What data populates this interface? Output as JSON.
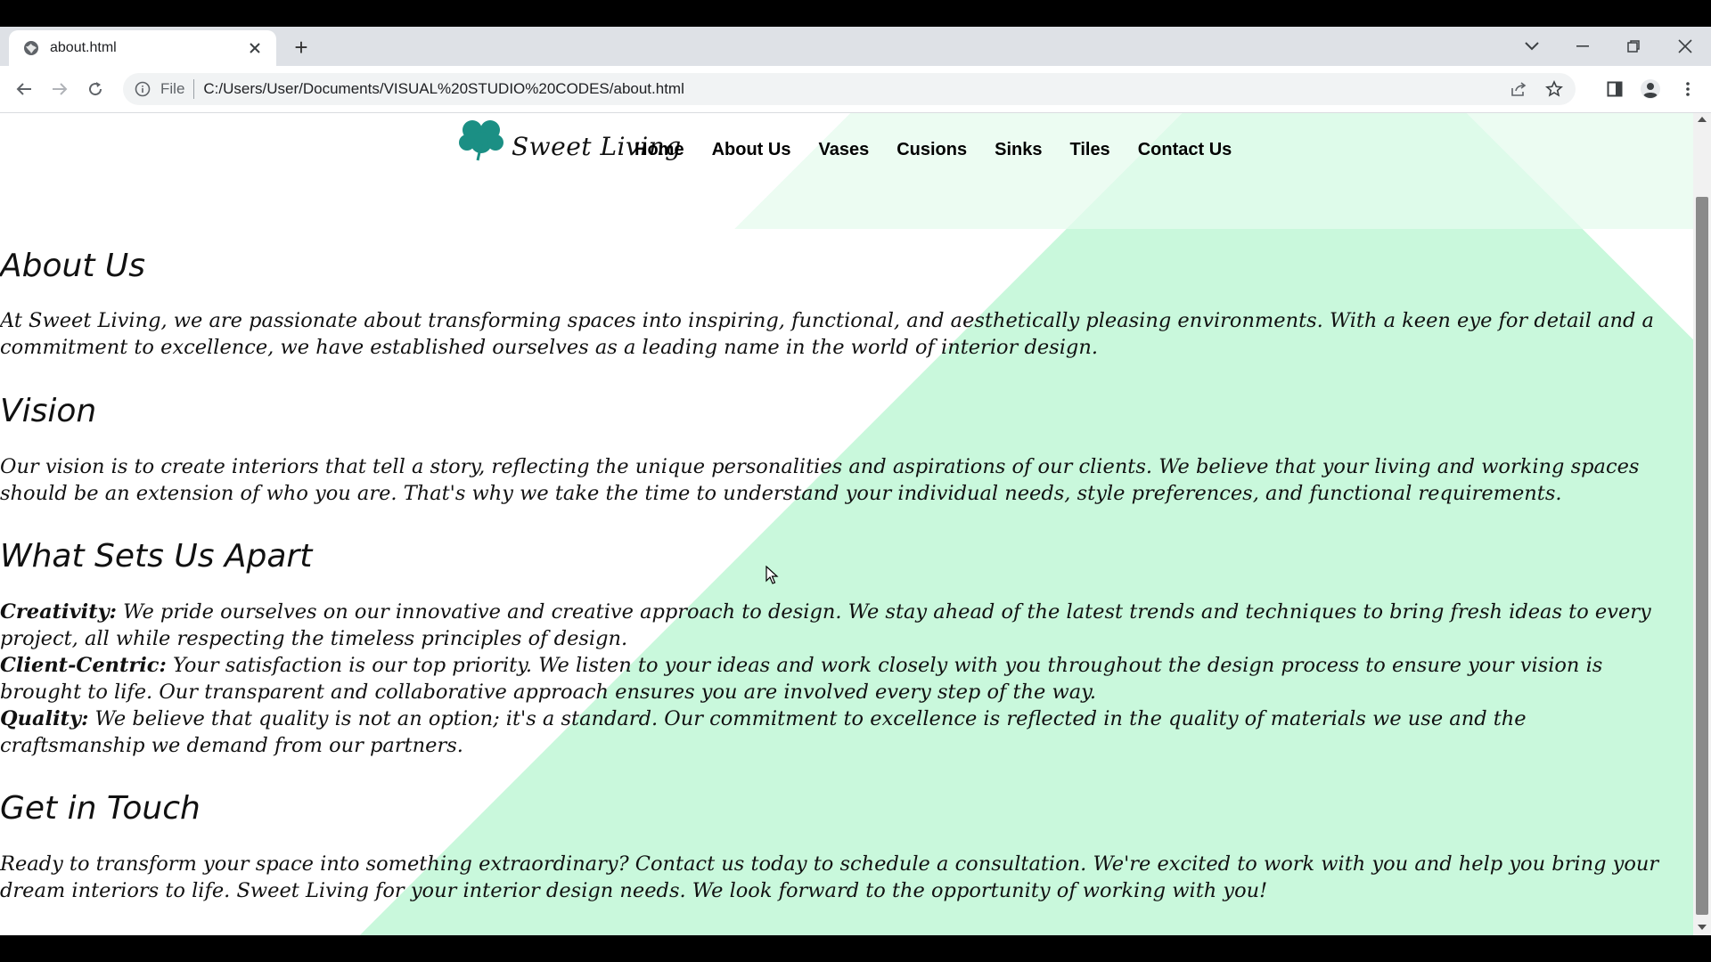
{
  "browser": {
    "tab_title": "about.html",
    "new_tab": "+",
    "omnibox": {
      "scheme_label": "File",
      "url": "C:/Users/User/Documents/VISUAL%20STUDIO%20CODES/about.html"
    }
  },
  "site": {
    "brand": "Sweet Living",
    "nav": [
      "Home",
      "About Us",
      "Vases",
      "Cusions",
      "Sinks",
      "Tiles",
      "Contact Us"
    ],
    "colors": {
      "mint": "#c9f8dc",
      "logo_teal": "#1b8f84"
    }
  },
  "content": {
    "about_heading": "About Us",
    "about_text": "At Sweet Living, we are passionate about transforming spaces into inspiring, functional, and aesthetically pleasing environments. With a keen eye for detail and a commitment to excellence, we have established ourselves as a leading name in the world of interior design.",
    "vision_heading": "Vision",
    "vision_text": "Our vision is to create interiors that tell a story, reflecting the unique personalities and aspirations of our clients. We believe that your living and working spaces should be an extension of who you are. That's why we take the time to understand your individual needs, style preferences, and functional requirements.",
    "apart_heading": "What Sets Us Apart",
    "points": [
      {
        "label": "Creativity:",
        "text": " We pride ourselves on our innovative and creative approach to design. We stay ahead of the latest trends and techniques to bring fresh ideas to every project, all while respecting the timeless principles of design."
      },
      {
        "label": "Client-Centric:",
        "text": " Your satisfaction is our top priority. We listen to your ideas and work closely with you throughout the design process to ensure your vision is brought to life. Our transparent and collaborative approach ensures you are involved every step of the way."
      },
      {
        "label": "Quality:",
        "text": " We believe that quality is not an option; it's a standard. Our commitment to excellence is reflected in the quality of materials we use and the craftsmanship we demand from our partners."
      }
    ],
    "touch_heading": "Get in Touch",
    "touch_text": "Ready to transform your space into something extraordinary? Contact us today to schedule a consultation. We're excited to work with you and help you bring your dream interiors to life. Sweet Living for your interior design needs. We look forward to the opportunity of working with you!"
  }
}
